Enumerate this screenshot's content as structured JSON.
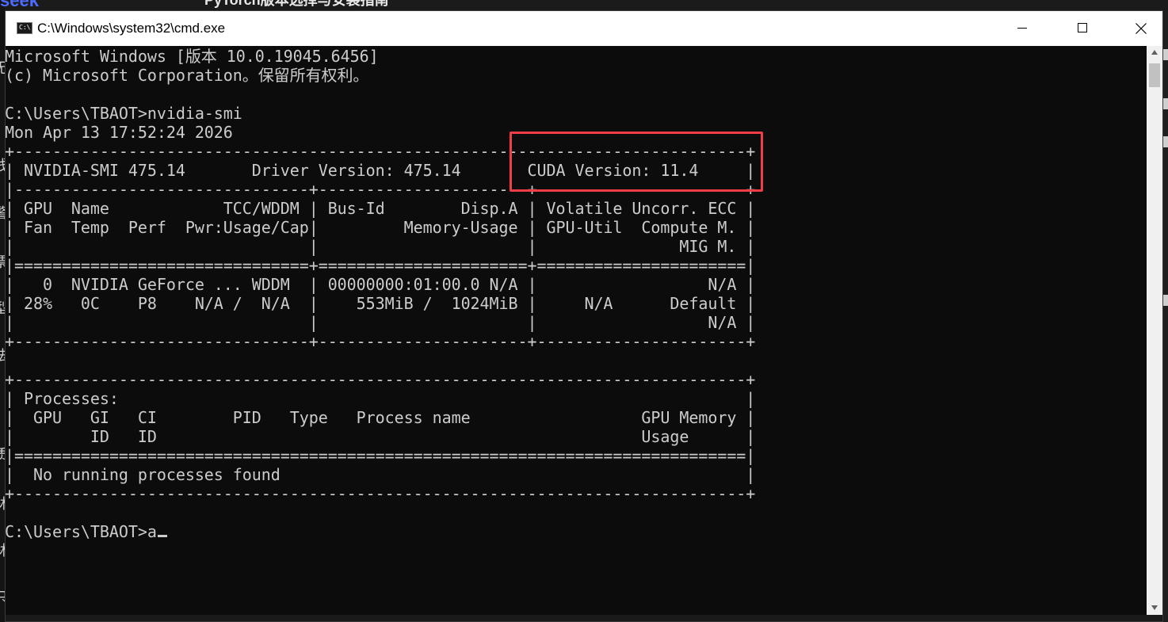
{
  "background_app": {
    "logo_text": "seek",
    "title_text": "PyTorch版本选择与安装指南",
    "side_glyphs": [
      "无",
      "钱",
      "警",
      "票",
      "型",
      "法",
      "质",
      "林",
      "林",
      "只"
    ]
  },
  "window": {
    "title": "C:\\Windows\\system32\\cmd.exe",
    "icon_label": "C:\\",
    "controls": {
      "minimize": "minimize",
      "maximize": "maximize",
      "close": "close"
    }
  },
  "console": {
    "lines": [
      "Microsoft Windows [版本 10.0.19045.6456]",
      "(c) Microsoft Corporation。保留所有权利。",
      "",
      "C:\\Users\\TBAOT>nvidia-smi",
      "Mon Apr 13 17:52:24 2026",
      "+-----------------------------------------------------------------------------+",
      "| NVIDIA-SMI 475.14       Driver Version: 475.14       CUDA Version: 11.4     |",
      "|-------------------------------+----------------------+----------------------+",
      "| GPU  Name            TCC/WDDM | Bus-Id        Disp.A | Volatile Uncorr. ECC |",
      "| Fan  Temp  Perf  Pwr:Usage/Cap|         Memory-Usage | GPU-Util  Compute M. |",
      "|                               |                      |               MIG M. |",
      "|===============================+======================+======================|",
      "|   0  NVIDIA GeForce ... WDDM  | 00000000:01:00.0 N/A |                  N/A |",
      "| 28%   0C    P8    N/A /  N/A  |    553MiB /  1024MiB |     N/A      Default |",
      "|                               |                      |                  N/A |",
      "+-------------------------------+----------------------+----------------------+",
      "",
      "+-----------------------------------------------------------------------------+",
      "| Processes:                                                                  |",
      "|  GPU   GI   CI        PID   Type   Process name                  GPU Memory |",
      "|        ID   ID                                                   Usage      |",
      "|=============================================================================|",
      "|  No running processes found                                                 |",
      "+-----------------------------------------------------------------------------+",
      ""
    ],
    "prompt": "C:\\Users\\TBAOT>",
    "input": "a"
  },
  "highlight": {
    "label": "CUDA Version: 11.4",
    "color": "#f03e48"
  },
  "colors": {
    "console_bg": "#0c0c0c",
    "console_fg": "#cccccc",
    "titlebar_bg": "#ffffff",
    "logo": "#4d6bfe"
  }
}
